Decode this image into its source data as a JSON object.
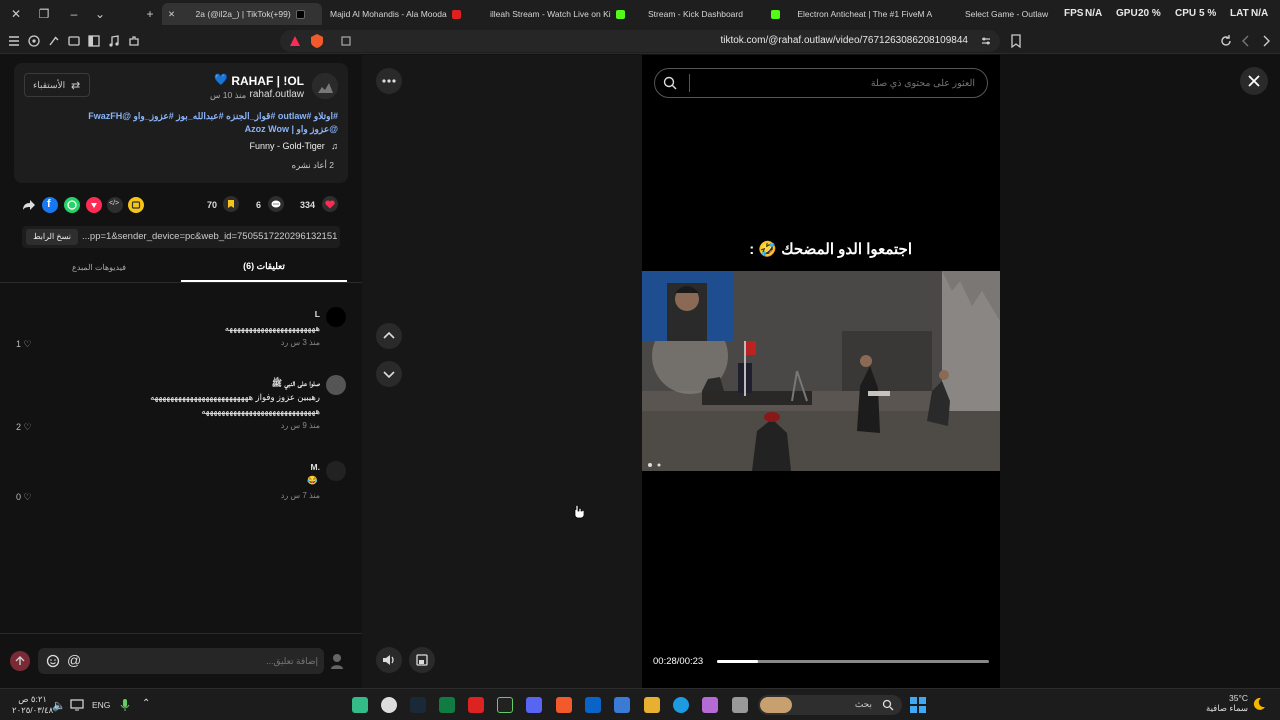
{
  "browser": {
    "tabs": [
      {
        "label": "2a (@il2a_) | TikTok(+99)",
        "active": true
      },
      {
        "label": "Majid Al Mohandis - Ala Mooda"
      },
      {
        "label": "illeah Stream - Watch Live on Ki"
      },
      {
        "label": "Stream - Kick Dashboard"
      },
      {
        "label": "Electron Anticheat | The #1 FiveM A"
      },
      {
        "label": "Select Game - Outlaw"
      }
    ],
    "overlay": {
      "fps_label": "FPS",
      "fps_value": "N/A",
      "gpu_label": "GPU",
      "gpu_value": "20 %",
      "cpu_label": "CPU",
      "cpu_value": "5 %",
      "lat_label": "LAT",
      "lat_value": "N/A"
    },
    "url": "tiktok.com/@rahaf.outlaw/video/7671263086208109844"
  },
  "post": {
    "author_name": "RAHAF | !OL",
    "heart": "💙",
    "username": "rahaf.outlaw",
    "time_ago": "منذ 10 س",
    "follow_label": "الأستقباء",
    "hashtags_line1": "#اوتلاو #outlaw #قواز_الجنزه #عبدالله_بوز #عزوز_واو @FwazFH",
    "hashtags_line2": "@عزوز واو | Azoz Wow",
    "music": "Funny - Gold-Tiger",
    "reposts": "2 أعاد نشره",
    "likes": "334",
    "comments_count": "6",
    "saves": "70",
    "link": "...pp=1&sender_device=pc&web_id=7505517220296132151",
    "copy_link_label": "نسخ الرابط"
  },
  "tabs": {
    "comments": "(6) تعليقات",
    "creator_videos": "فيديوهات المبدع"
  },
  "comments": [
    {
      "name": "L",
      "text": "هههههههههههههههههههههههه",
      "meta": "منذ 3 س   رد",
      "likes": "1"
    },
    {
      "name": "صلوا على النبي ﷺ",
      "text": "رهيبين عزوز وفواز هههههههههههههههههههههههههه",
      "text2": "هههههههههههههههههههههههههههههه",
      "meta": "منذ 9 س   رد",
      "likes": "2"
    },
    {
      "name": "M.",
      "text": "😂",
      "meta": "منذ 7 س   رد",
      "likes": "0"
    }
  ],
  "comment_input": {
    "placeholder": "إضافة تعليق..."
  },
  "video": {
    "search_placeholder": "العثور على محتوى ذي صلة",
    "caption": "اجتمعوا الدو المضحك 🤣 :",
    "time": "00:28/00:23",
    "progress": 0.15
  },
  "taskbar": {
    "search_placeholder": "بحث",
    "lang": "ENG",
    "weather_temp": "35°C",
    "weather_desc": "سماء صافية",
    "clock_time": "٥:٢١ ص",
    "clock_date": "٢٠٢٥/٠٣/٤٨"
  },
  "colors": {
    "accent": "#fe2c55",
    "link": "#8ab4f8"
  }
}
